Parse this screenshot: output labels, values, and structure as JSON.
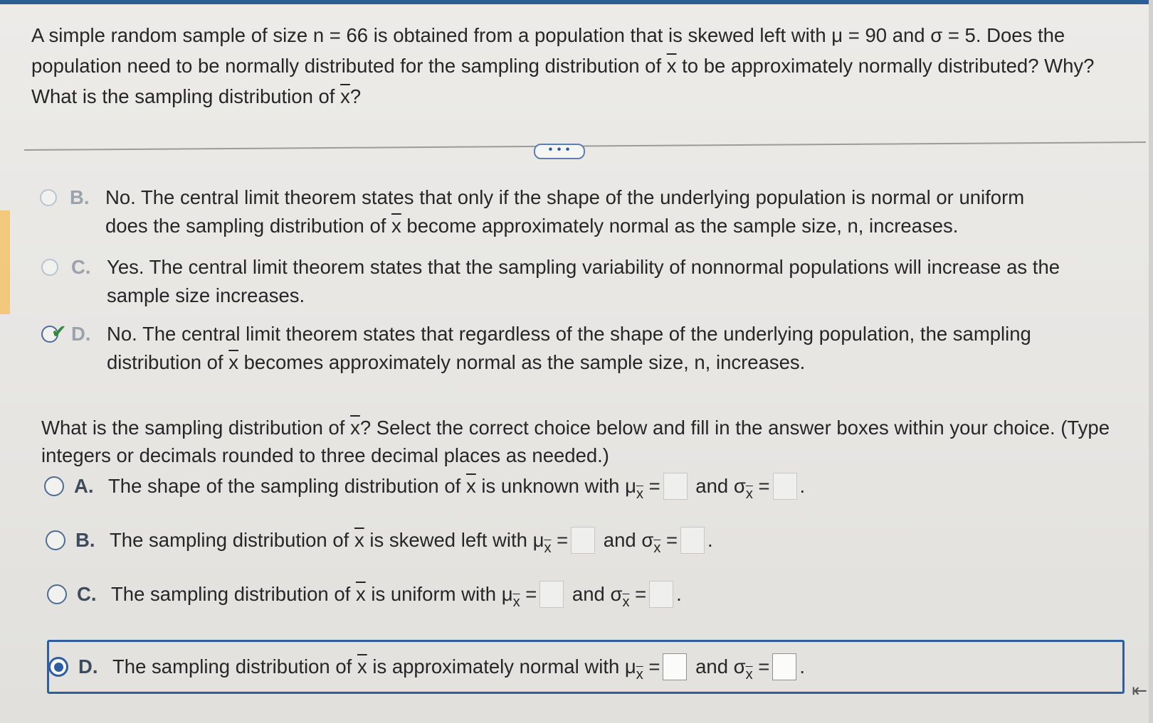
{
  "question": {
    "line1_pre": "A simple random sample of size n = 66 is obtained from a population that is skewed left with μ = 90 and σ = 5. Does the population need to be normally distributed for the sampling distribution of ",
    "xbar": "x",
    "line1_post": " to be approximately normally distributed? Why? What is the sampling distribution of ",
    "end": "?"
  },
  "more_button": "• • •",
  "part1_options": [
    {
      "letter": "B.",
      "pre": "No. The central limit theorem states that only if the shape of the underlying population is normal or uniform does the sampling distribution of ",
      "x": "x",
      "post": " become approximately normal as the sample size, n, increases."
    },
    {
      "letter": "C.",
      "text": "Yes. The central limit theorem states that the sampling variability of nonnormal populations will increase as the sample size increases."
    },
    {
      "letter": "D.",
      "pre": "No. The central limit theorem states that regardless of the shape of the underlying population, the sampling distribution of ",
      "x": "x",
      "post": " becomes approximately normal as the sample size, n, increases."
    }
  ],
  "part2": {
    "prompt_pre": "What is the sampling distribution of ",
    "prompt_x": "x",
    "prompt_post": "? Select the correct choice below and fill in the answer boxes within your choice. (Type integers or decimals rounded to three decimal places as needed.)",
    "options": [
      {
        "letter": "A.",
        "pre": "The shape of the sampling distribution of ",
        "x": "x",
        "post": " is unknown with "
      },
      {
        "letter": "B.",
        "pre": "The sampling distribution of ",
        "x": "x",
        "post": " is skewed left with "
      },
      {
        "letter": "C.",
        "pre": "The sampling distribution of ",
        "x": "x",
        "post": " is uniform with "
      },
      {
        "letter": "D.",
        "pre": "The sampling distribution of ",
        "x": "x",
        "post": " is approximately normal with "
      }
    ],
    "mu": "μ",
    "sigma": "σ",
    "sub": "x",
    "eq": "=",
    "and": "and",
    "period": "."
  },
  "selected_part2": "D"
}
